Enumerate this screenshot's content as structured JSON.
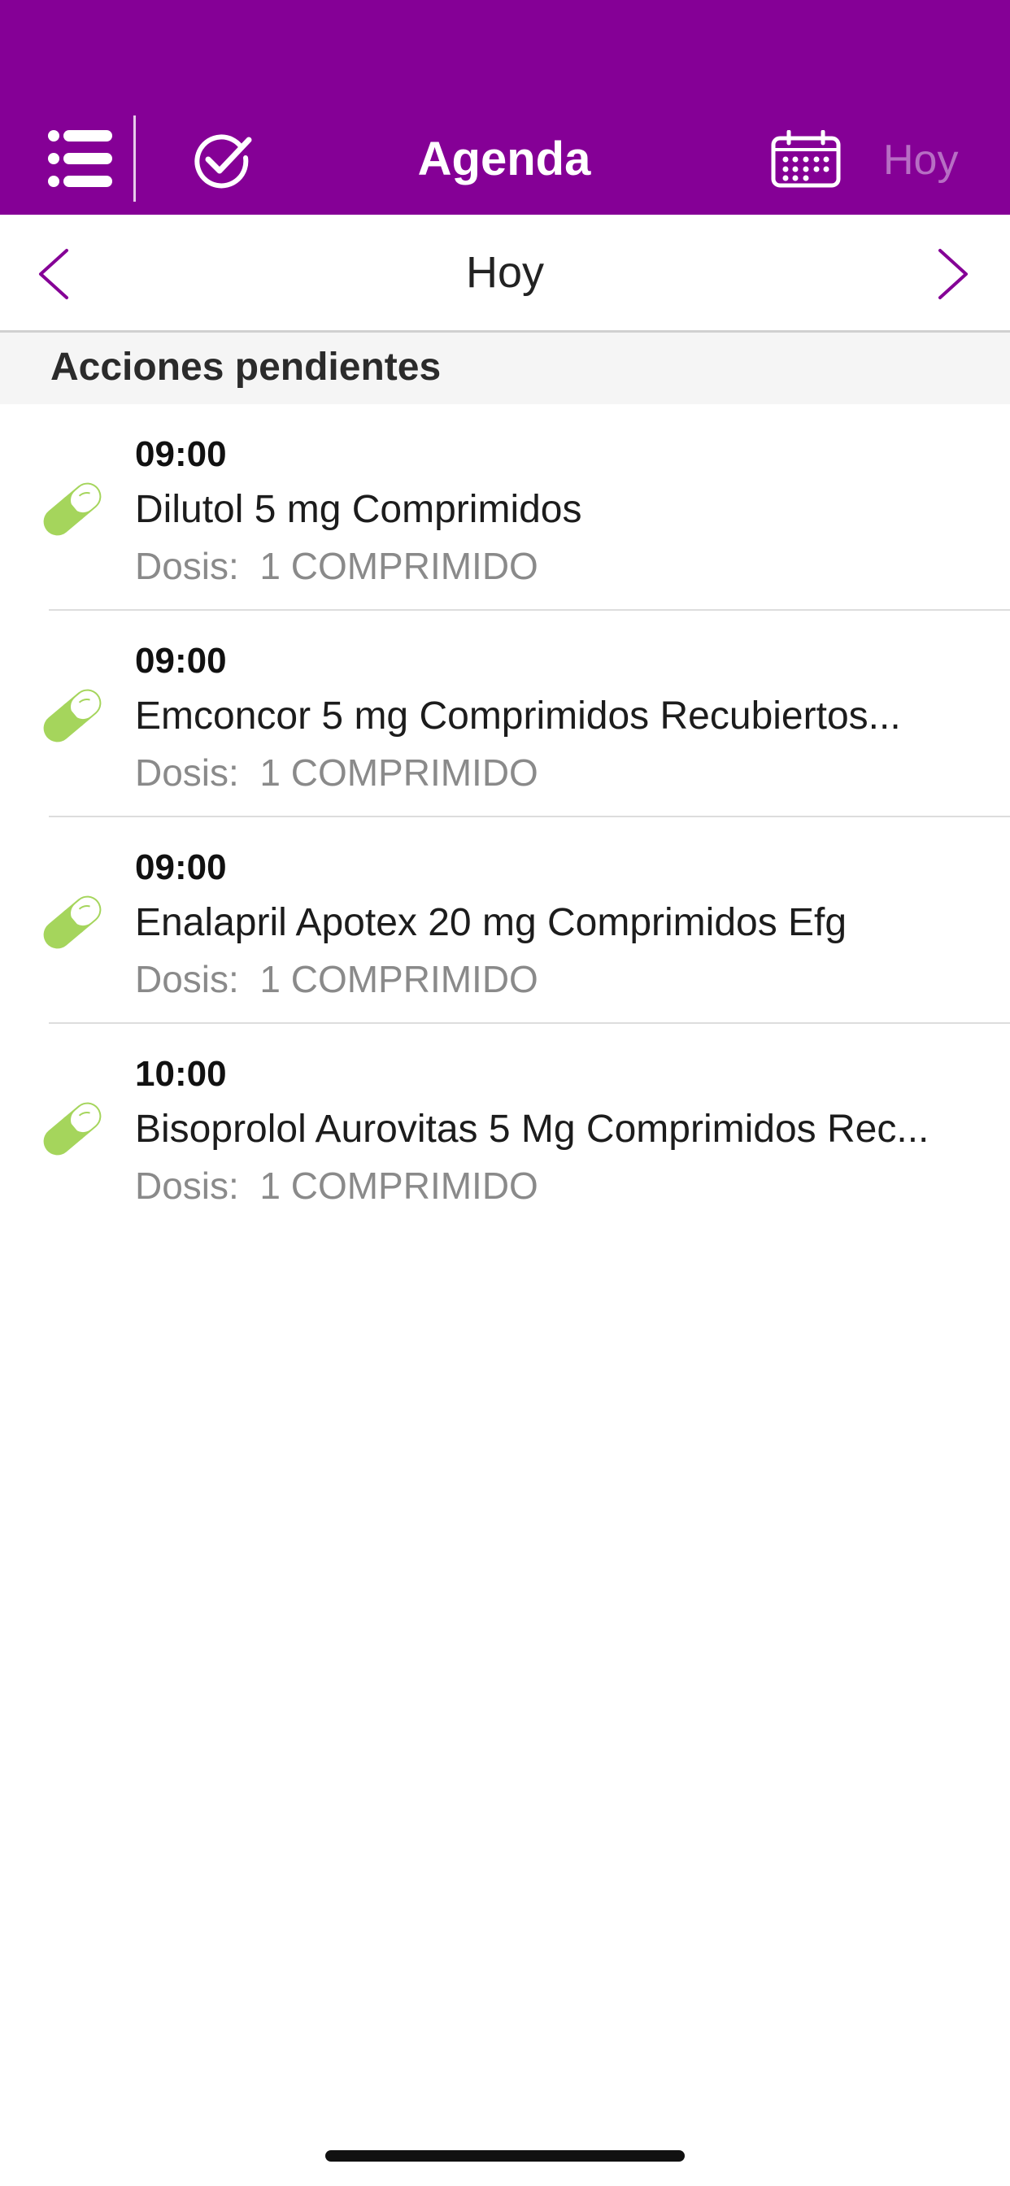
{
  "header": {
    "title": "Agenda",
    "today_label": "Hoy",
    "background": "#850096",
    "icons": [
      "list-menu-icon",
      "check-circle-icon",
      "calendar-icon"
    ]
  },
  "datebar": {
    "label": "Hoy",
    "prev_icon": "chevron-left-icon",
    "next_icon": "chevron-right-icon",
    "accent": "#850096"
  },
  "section": {
    "title": "Acciones pendientes"
  },
  "items": [
    {
      "time": "09:00",
      "name": "Dilutol 5 mg Comprimidos",
      "dose": "Dosis:  1 COMPRIMIDO"
    },
    {
      "time": "09:00",
      "name": "Emconcor 5 mg Comprimidos Recubiertos...",
      "dose": "Dosis:  1 COMPRIMIDO"
    },
    {
      "time": "09:00",
      "name": "Enalapril Apotex 20 mg Comprimidos Efg",
      "dose": "Dosis:  1 COMPRIMIDO"
    },
    {
      "time": "10:00",
      "name": "Bisoprolol Aurovitas 5 Mg Comprimidos Rec...",
      "dose": "Dosis:  1 COMPRIMIDO"
    }
  ],
  "colors": {
    "pill": "#a5d55c",
    "dose_text": "#8a8a8a"
  }
}
